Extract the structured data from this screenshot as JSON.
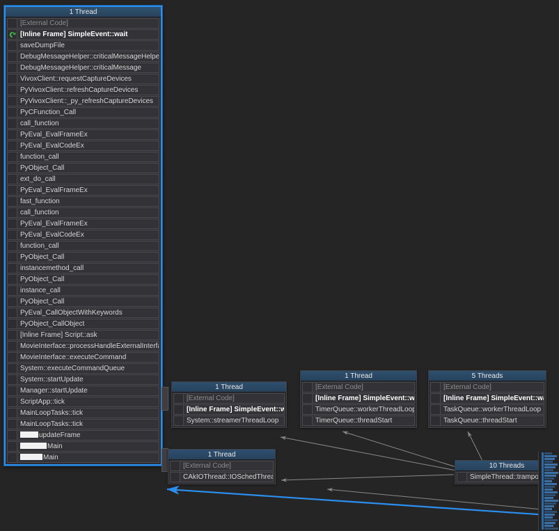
{
  "app": {
    "view_name": "parallel-stacks",
    "background_color": "#252526",
    "accent_color": "#2b8ff0",
    "header_color": "#2f4f6e",
    "current_frame_marker_color": "#4ec04e"
  },
  "nodes": [
    {
      "id": "main-thread",
      "title": "1 Thread",
      "selected": true,
      "frames": [
        {
          "label": "[External Code]",
          "style": "external",
          "marker": false
        },
        {
          "label": "[Inline Frame] SimpleEvent::wait",
          "style": "current",
          "marker": true
        },
        {
          "label": "saveDumpFile",
          "style": "normal",
          "marker": false
        },
        {
          "label": "DebugMessageHelper::criticalMessageHelper",
          "style": "normal",
          "marker": false
        },
        {
          "label": "DebugMessageHelper::criticalMessage",
          "style": "normal",
          "marker": false
        },
        {
          "label": "VivoxClient::requestCaptureDevices",
          "style": "normal",
          "marker": false
        },
        {
          "label": "PyVivoxClient::refreshCaptureDevices",
          "style": "normal",
          "marker": false
        },
        {
          "label": "PyVivoxClient::_py_refreshCaptureDevices",
          "style": "normal",
          "marker": false
        },
        {
          "label": "PyCFunction_Call",
          "style": "normal",
          "marker": false
        },
        {
          "label": "call_function",
          "style": "normal",
          "marker": false
        },
        {
          "label": "PyEval_EvalFrameEx",
          "style": "normal",
          "marker": false
        },
        {
          "label": "PyEval_EvalCodeEx",
          "style": "normal",
          "marker": false
        },
        {
          "label": "function_call",
          "style": "normal",
          "marker": false
        },
        {
          "label": "PyObject_Call",
          "style": "normal",
          "marker": false
        },
        {
          "label": "ext_do_call",
          "style": "normal",
          "marker": false
        },
        {
          "label": "PyEval_EvalFrameEx",
          "style": "normal",
          "marker": false
        },
        {
          "label": "fast_function",
          "style": "normal",
          "marker": false
        },
        {
          "label": "call_function",
          "style": "normal",
          "marker": false
        },
        {
          "label": "PyEval_EvalFrameEx",
          "style": "normal",
          "marker": false
        },
        {
          "label": "PyEval_EvalCodeEx",
          "style": "normal",
          "marker": false
        },
        {
          "label": "function_call",
          "style": "normal",
          "marker": false
        },
        {
          "label": "PyObject_Call",
          "style": "normal",
          "marker": false
        },
        {
          "label": "instancemethod_call",
          "style": "normal",
          "marker": false
        },
        {
          "label": "PyObject_Call",
          "style": "normal",
          "marker": false
        },
        {
          "label": "instance_call",
          "style": "normal",
          "marker": false
        },
        {
          "label": "PyObject_Call",
          "style": "normal",
          "marker": false
        },
        {
          "label": "PyEval_CallObjectWithKeywords",
          "style": "normal",
          "marker": false
        },
        {
          "label": "PyObject_CallObject",
          "style": "normal",
          "marker": false
        },
        {
          "label": "[Inline Frame] Script::ask",
          "style": "normal",
          "marker": false
        },
        {
          "label": "MovieInterface::processHandleExternalInterfa...",
          "style": "normal",
          "marker": false
        },
        {
          "label": "MovieInterface::executeCommand",
          "style": "normal",
          "marker": false
        },
        {
          "label": "System::executeCommandQueue",
          "style": "normal",
          "marker": false
        },
        {
          "label": "System::startUpdate",
          "style": "normal",
          "marker": false
        },
        {
          "label": "Manager::startUpdate",
          "style": "normal",
          "marker": false
        },
        {
          "label": "ScriptApp::tick",
          "style": "normal",
          "marker": false
        },
        {
          "label": "MainLoopTasks::tick",
          "style": "normal",
          "marker": false
        },
        {
          "label": "MainLoopTasks::tick",
          "style": "normal",
          "marker": false
        },
        {
          "label": "updateFrame",
          "style": "normal",
          "marker": false,
          "redacted_prefix_width": 26
        },
        {
          "label": "Main",
          "style": "normal",
          "marker": false,
          "redacted_prefix_width": 38
        },
        {
          "label": "Main",
          "style": "normal",
          "marker": false,
          "redacted_prefix_width": 32
        }
      ]
    },
    {
      "id": "streamer-thread",
      "title": "1 Thread",
      "selected": false,
      "frames": [
        {
          "label": "[External Code]",
          "style": "external",
          "marker": false
        },
        {
          "label": "[Inline Frame] SimpleEvent::wait",
          "style": "current",
          "marker": false
        },
        {
          "label": "System::streamerThreadLoop",
          "style": "normal",
          "marker": false
        }
      ]
    },
    {
      "id": "timer-queue-thread",
      "title": "1 Thread",
      "selected": false,
      "frames": [
        {
          "label": "[External Code]",
          "style": "external",
          "marker": false
        },
        {
          "label": "[Inline Frame] SimpleEvent::wait",
          "style": "current",
          "marker": false
        },
        {
          "label": "TimerQueue::workerThreadLoop",
          "style": "normal",
          "marker": false
        },
        {
          "label": "TimerQueue::threadStart",
          "style": "normal",
          "marker": false
        }
      ]
    },
    {
      "id": "task-queue-threads",
      "title": "5 Threads",
      "selected": false,
      "frames": [
        {
          "label": "[External Code]",
          "style": "external",
          "marker": false
        },
        {
          "label": "[Inline Frame] SimpleEvent::wait",
          "style": "current",
          "marker": false
        },
        {
          "label": "TaskQueue::workerThreadLoop",
          "style": "normal",
          "marker": false
        },
        {
          "label": "TaskQueue::threadStart",
          "style": "normal",
          "marker": false
        }
      ]
    },
    {
      "id": "io-sched-thread",
      "title": "1 Thread",
      "selected": false,
      "frames": [
        {
          "label": "[External Code]",
          "style": "external",
          "marker": false
        },
        {
          "label": "CAkIOThread::IOSchedThread",
          "style": "normal",
          "marker": false
        }
      ]
    },
    {
      "id": "simple-thread-trampoline",
      "title": "10 Threads",
      "selected": false,
      "frames": [
        {
          "label": "SimpleThread::trampolin",
          "style": "normal",
          "marker": false
        }
      ]
    }
  ]
}
